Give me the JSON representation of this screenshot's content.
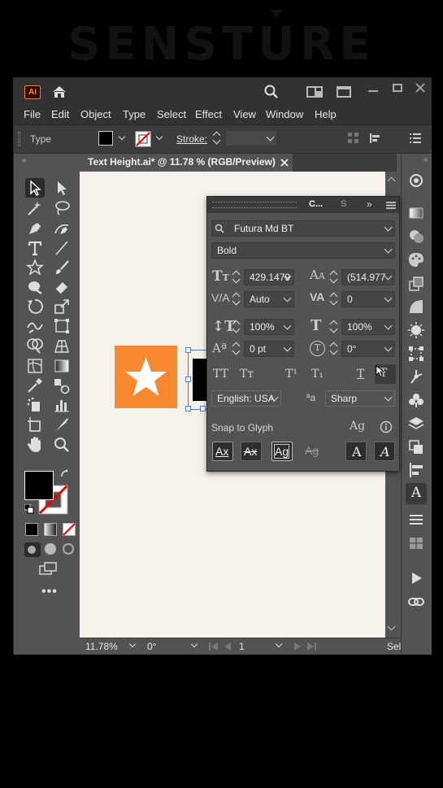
{
  "watermark": "SENSTURE",
  "app": {
    "logo": "Ai"
  },
  "menu": [
    "File",
    "Edit",
    "Object",
    "Type",
    "Select",
    "Effect",
    "View",
    "Window",
    "Help"
  ],
  "control_bar": {
    "mode_label": "Type",
    "stroke_label": "Stroke:"
  },
  "document": {
    "tab_title": "Text Height.ai* @ 11.78 % (RGB/Preview)"
  },
  "character_panel": {
    "tabs": [
      "C...",
      "S"
    ],
    "font_family": "Futura Md BT",
    "font_style": "Bold",
    "font_size": "429.1479",
    "leading": "(514.977",
    "kerning": "Auto",
    "tracking": "0",
    "vertical_scale": "100%",
    "horizontal_scale": "100%",
    "baseline_shift": "0 pt",
    "rotation": "0°",
    "style_buttons": [
      "TT",
      "Tт",
      "T¹",
      "T₁",
      "T",
      "Ŧ"
    ],
    "language": "English: USA",
    "antialias_icon": "ªa",
    "antialias": "Sharp",
    "snap_to_glyph_label": "Snap to Glyph"
  },
  "status_bar": {
    "zoom": "11.78%",
    "rotate": "0°",
    "artboard": "1",
    "info": "Sel"
  },
  "colors": {
    "accent_orange": "#f7882f",
    "ui_dark": "#323232",
    "panel": "#535353",
    "canvas": "#f6f2ea"
  }
}
